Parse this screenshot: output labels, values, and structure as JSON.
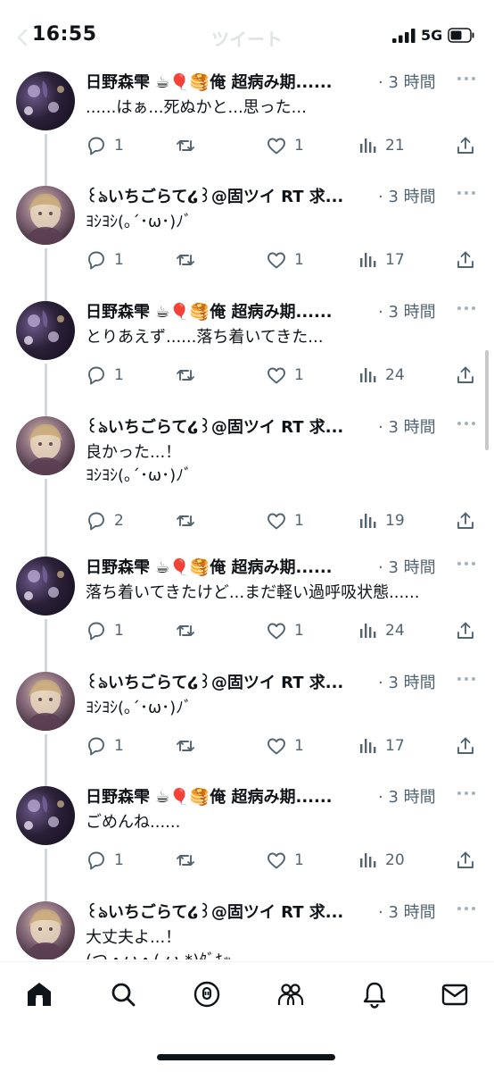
{
  "status_bar": {
    "time": "16:55",
    "network": "5G"
  },
  "header": {
    "title": "ツイート"
  },
  "tweets": [
    {
      "author": "日野森雫 ☕🎈🥞俺 超病み期......",
      "time": "· 3 時間",
      "text": [
        "......はぁ...死ぬかと...思った..."
      ],
      "replies": "1",
      "likes": "1",
      "views": "21",
      "avatar": "hino"
    },
    {
      "author": "꒰ঌいちごらて໒꒱@固ツイ RT 求...",
      "time": "· 3 時間",
      "text": [
        "ﾖｼﾖｼ(｡´･ω･)ﾉﾞ"
      ],
      "replies": "1",
      "likes": "1",
      "views": "17",
      "avatar": "ichigo"
    },
    {
      "author": "日野森雫 ☕🎈🥞俺 超病み期......",
      "time": "· 3 時間",
      "text": [
        "とりあえず......落ち着いてきた..."
      ],
      "replies": "1",
      "likes": "1",
      "views": "24",
      "avatar": "hino"
    },
    {
      "author": "꒰ঌいちごらて໒꒱@固ツイ RT 求...",
      "time": "· 3 時間",
      "text": [
        "良かった...！",
        "ﾖｼﾖｼ(｡´･ω･)ﾉﾞ"
      ],
      "replies": "2",
      "likes": "1",
      "views": "19",
      "avatar": "ichigo"
    },
    {
      "author": "日野森雫 ☕🎈🥞俺 超病み期......",
      "time": "· 3 時間",
      "text": [
        "落ち着いてきたけど...まだ軽い過呼吸状態......"
      ],
      "replies": "1",
      "likes": "1",
      "views": "24",
      "avatar": "hino"
    },
    {
      "author": "꒰ঌいちごらて໒꒱@固ツイ RT 求...",
      "time": "· 3 時間",
      "text": [
        "ﾖｼﾖｼ(｡´･ω･)ﾉﾞ"
      ],
      "replies": "1",
      "likes": "1",
      "views": "17",
      "avatar": "ichigo"
    },
    {
      "author": "日野森雫 ☕🎈🥞俺 超病み期......",
      "time": "· 3 時間",
      "text": [
        "ごめんね......"
      ],
      "replies": "1",
      "likes": "1",
      "views": "20",
      "avatar": "hino"
    },
    {
      "author": "꒰ঌいちごらて໒꒱@固ツイ RT 求...",
      "time": "· 3 時間",
      "text": [
        "大丈夫よ...！",
        "(つ・ω・(-ω-*)ﾀﾞｷｯ"
      ],
      "replies": "",
      "likes": "",
      "views": "",
      "avatar": "ichigo"
    }
  ],
  "bottom_nav": [
    {
      "name": "home-icon"
    },
    {
      "name": "search-icon"
    },
    {
      "name": "spaces-icon"
    },
    {
      "name": "communities-icon"
    },
    {
      "name": "notifications-icon"
    },
    {
      "name": "messages-icon"
    }
  ],
  "colors": {
    "text": "#0f1419",
    "secondary": "#536471",
    "thread_line": "#cfd9de"
  }
}
